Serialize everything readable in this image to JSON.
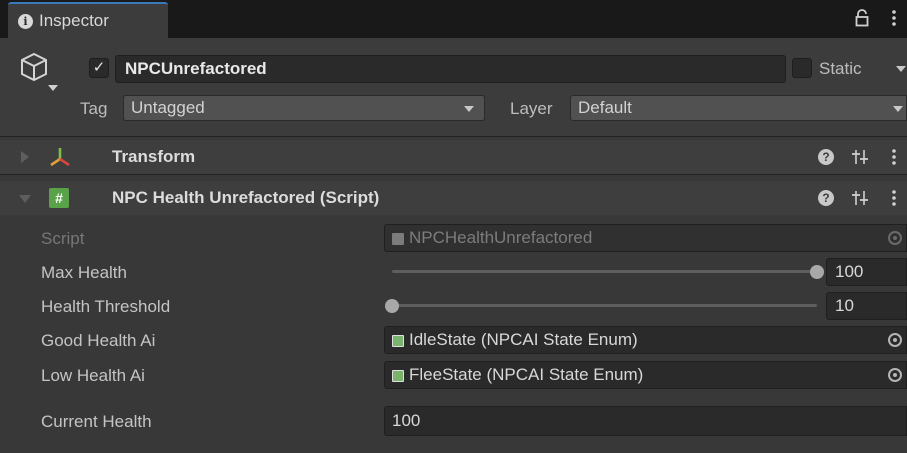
{
  "tab": {
    "label": "Inspector",
    "icon": "info-icon"
  },
  "toolbar_icons": [
    "lock-icon",
    "kebab-menu-icon"
  ],
  "gameobject": {
    "icon": "cube-icon",
    "active_checked": true,
    "name": "NPCUnrefactored",
    "static_label": "Static",
    "static_checked": false,
    "tag_label": "Tag",
    "tag_value": "Untagged",
    "layer_label": "Layer",
    "layer_value": "Default"
  },
  "components": [
    {
      "title": "Transform",
      "expanded": false,
      "icon": "transform-axes-icon"
    },
    {
      "title": "NPC Health Unrefactored (Script)",
      "expanded": true,
      "icon": "csharp-script-icon"
    }
  ],
  "properties": {
    "script": {
      "label": "Script",
      "value": "NPCHealthUnrefactored"
    },
    "max_health": {
      "label": "Max Health",
      "value": "100",
      "fraction": 1.0
    },
    "health_threshold": {
      "label": "Health Threshold",
      "value": "10",
      "fraction": 0.0
    },
    "good_health_ai": {
      "label": "Good Health Ai",
      "value": "IdleState (NPCAI State Enum)"
    },
    "low_health_ai": {
      "label": "Low Health Ai",
      "value": "FleeState (NPCAI State Enum)"
    },
    "current_health": {
      "label": "Current Health",
      "value": "100"
    }
  },
  "colors": {
    "tab_accent": "#3a79bb",
    "script_icon": "#5aa24a",
    "background": "#383838"
  }
}
